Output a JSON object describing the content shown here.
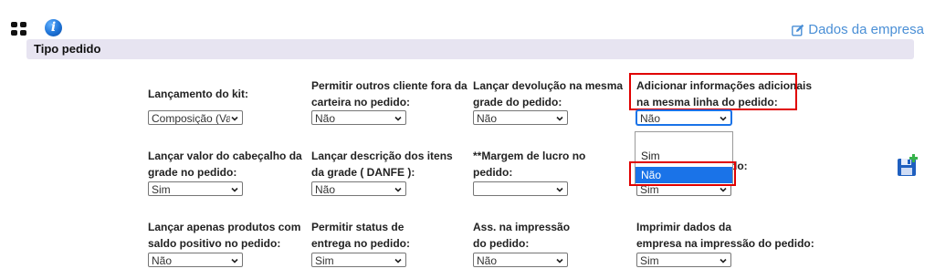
{
  "toolbar": {
    "grid_icon": "grid-icon",
    "info_icon": "info-icon",
    "info_glyph": "i",
    "company_link_label": "Dados da empresa",
    "company_link_icon": "edit-icon"
  },
  "section": {
    "title": "Tipo pedido"
  },
  "fields": [
    {
      "label_line1": "Lançamento do kit:",
      "label_line2": "",
      "value": "Composição (Valor dos itens)"
    },
    {
      "label_line1": "Permitir outros cliente fora da",
      "label_line2": "carteira no pedido:",
      "value": "Não"
    },
    {
      "label_line1": "Lançar devolução na mesma",
      "label_line2": "grade do pedido:",
      "value": "Não"
    },
    {
      "label_line1": "Adicionar informações adicionais",
      "label_line2": "na mesma linha do pedido:",
      "value": "Não"
    },
    {
      "label_line1": "Lançar valor do cabeçalho da",
      "label_line2": "grade no pedido:",
      "value": "Sim"
    },
    {
      "label_line1": "Lançar descrição dos itens",
      "label_line2": "da grade ( DANFE ):",
      "value": "Não"
    },
    {
      "label_line1": "**Margem de lucro no",
      "label_line2": "pedido:",
      "value": ""
    },
    {
      "label_line1": "",
      "label_line2": "do:",
      "value": "Sim"
    },
    {
      "label_line1": "Lançar apenas produtos com",
      "label_line2": "saldo positivo no pedido:",
      "value": "Não"
    },
    {
      "label_line1": "Permitir status de",
      "label_line2": "entrega no pedido:",
      "value": "Sim"
    },
    {
      "label_line1": "Ass. na impressão",
      "label_line2": "do pedido:",
      "value": "Não"
    },
    {
      "label_line1": "Imprimir dados da",
      "label_line2": "empresa na impressão do pedido:",
      "value": "Sim"
    }
  ],
  "dropdown": {
    "options": [
      "Sim",
      "Não"
    ],
    "selected": "Não"
  },
  "actions": {
    "save_icon": "save-icon"
  },
  "colors": {
    "section_bg": "#e7e4f1",
    "link": "#4a8fd6",
    "highlight": "#e00000",
    "option_selected": "#1a73e8"
  }
}
